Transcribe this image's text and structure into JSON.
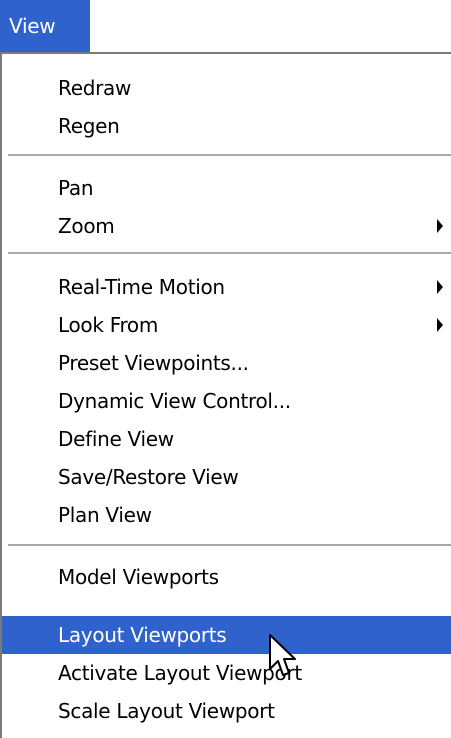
{
  "menu": {
    "title": "View",
    "items": [
      {
        "label": "Redraw"
      },
      {
        "label": "Regen"
      },
      {
        "label": "Pan"
      },
      {
        "label": "Zoom"
      },
      {
        "label": "Real-Time Motion"
      },
      {
        "label": "Look From"
      },
      {
        "label": "Preset Viewpoints..."
      },
      {
        "label": "Dynamic View Control..."
      },
      {
        "label": "Define View"
      },
      {
        "label": "Save/Restore View"
      },
      {
        "label": "Plan View"
      },
      {
        "label": "Model Viewports"
      },
      {
        "label": "Layout Viewports"
      },
      {
        "label": "Activate Layout Viewport"
      },
      {
        "label": "Scale Layout Viewport"
      }
    ]
  },
  "colors": {
    "highlight": "#2f62cc",
    "highlight_text": "#ffffff"
  },
  "icons": {
    "submenu": "triangle-right-icon",
    "cursor": "arrow-pointer-icon"
  }
}
